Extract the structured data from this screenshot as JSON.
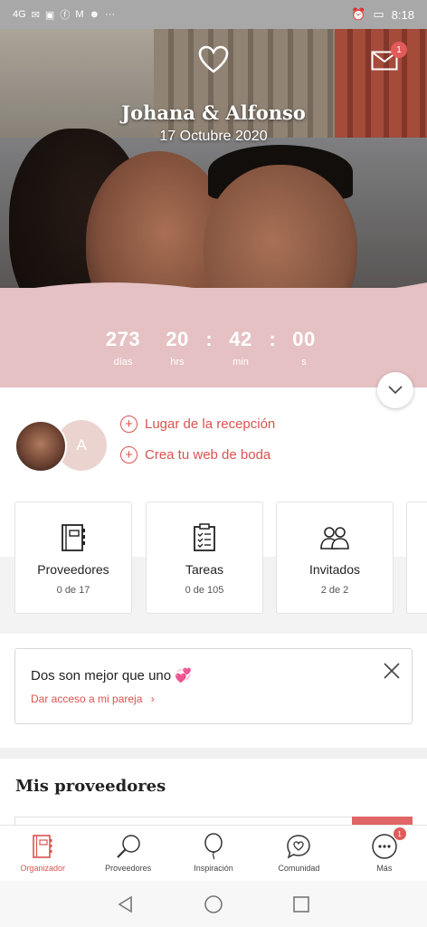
{
  "status_bar": {
    "signal": "4G",
    "time": "8:18",
    "notification_overflow": "···"
  },
  "header": {
    "couple_names": "Johana & Alfonso",
    "wedding_date": "17 Octubre 2020",
    "mail_badge": "1"
  },
  "countdown": {
    "days": "273",
    "days_label": "días",
    "hours": "20",
    "hours_label": "hrs",
    "minutes": "42",
    "minutes_label": "min",
    "seconds": "00",
    "seconds_label": "s",
    "sep": ":"
  },
  "profile": {
    "partner_initial": "A",
    "actions": [
      {
        "label": "Lugar de la recepción"
      },
      {
        "label": "Crea tu web de boda"
      }
    ]
  },
  "cards": [
    {
      "title": "Proveedores",
      "subtitle": "0 de 17",
      "icon": "planner-icon"
    },
    {
      "title": "Tareas",
      "subtitle": "0 de 105",
      "icon": "checklist-icon"
    },
    {
      "title": "Invitados",
      "subtitle": "2 de 2",
      "icon": "guests-icon"
    }
  ],
  "promo": {
    "title": "Dos son mejor que uno 💞",
    "link": "Dar acceso a mi pareja",
    "link_chevron": "›"
  },
  "section": {
    "title": "Mis proveedores"
  },
  "bottom_nav": [
    {
      "label": "Organizador",
      "active": true
    },
    {
      "label": "Proveedores"
    },
    {
      "label": "Inspiración"
    },
    {
      "label": "Comunidad"
    },
    {
      "label": "Más",
      "badge": "1"
    }
  ],
  "colors": {
    "accent": "#d9534f",
    "countdown_band": "#e5c1c3",
    "badge": "#e25b5b"
  }
}
